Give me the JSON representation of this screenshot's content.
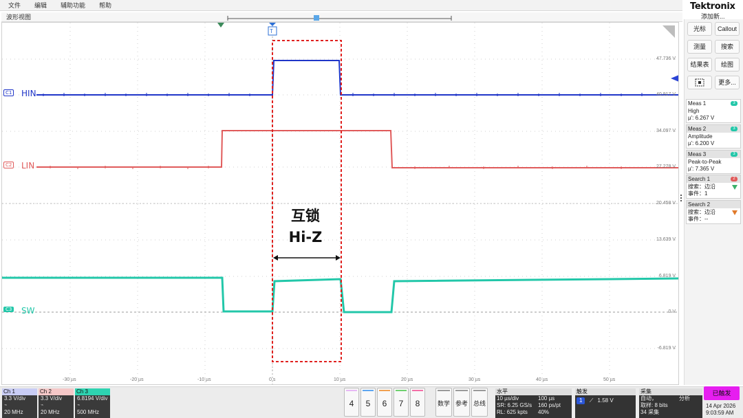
{
  "app": {
    "brand": "Tektronix",
    "add_new": "添加新...",
    "menu": [
      "文件",
      "编辑",
      "辅助功能",
      "帮助"
    ]
  },
  "waveform_view": {
    "title": "波形视图",
    "trigger_marker": "T",
    "overview_marker": "T",
    "volt_labels": [
      "47.736 V",
      "40.917 V",
      "34.097 V",
      "27.278 V",
      "20.458 V",
      "13.639 V",
      "6.819 V",
      "0 V",
      "-6.819 V"
    ],
    "time_labels": [
      "-30 µs",
      "-20 µs",
      "-10 µs",
      "0 s",
      "10 µs",
      "20 µs",
      "30 µs",
      "40 µs",
      "50 µs"
    ],
    "channels": [
      {
        "badge": "C1",
        "name": "HIN",
        "color": "#1f35c8"
      },
      {
        "badge": "C2",
        "name": "LIN",
        "color": "#e05a5a"
      },
      {
        "badge": "C3",
        "name": "SW",
        "color": "#22c7a9"
      }
    ],
    "annotation_line1": "互锁",
    "annotation_line2": "Hi-Z"
  },
  "right_panel": {
    "buttons": [
      {
        "label": "光标",
        "name": "cursor-button"
      },
      {
        "label": "Callout",
        "name": "callout-button"
      },
      {
        "label": "测量",
        "name": "measure-button"
      },
      {
        "label": "搜索",
        "name": "search-button"
      },
      {
        "label": "结果表",
        "name": "results-table-button"
      },
      {
        "label": "绘图",
        "name": "plot-button"
      },
      {
        "label": "更多...",
        "name": "more-button"
      }
    ],
    "measurements": [
      {
        "title": "Meas 1",
        "type": "High",
        "value": "µ': 6.267 V",
        "badge": "3"
      },
      {
        "title": "Meas 2",
        "type": "Amplitude",
        "value": "µ': 6.200 V",
        "badge": "3"
      },
      {
        "title": "Meas 3",
        "type": "Peak-to-Peak",
        "value": "µ': 7.365 V",
        "badge": "3"
      }
    ],
    "searches": [
      {
        "title": "Search 1",
        "line1": "搜索：边沿",
        "line2": "事件：1",
        "badge": "2",
        "badge_color": "#e05a5a",
        "tri_color": "#3cb06b"
      },
      {
        "title": "Search 2",
        "line1": "搜索：边沿",
        "line2": "事件：--",
        "tri_color": "#e07a2a"
      }
    ]
  },
  "bottom": {
    "channels": [
      {
        "name": "Ch 1",
        "scale": "3.3 V/div",
        "bw": "20 MHz",
        "color": "#c9cdf5"
      },
      {
        "name": "Ch 2",
        "scale": "3.3 V/div",
        "bw": "20 MHz",
        "color": "#f5c8c8"
      },
      {
        "name": "Ch 3",
        "scale": "6.8194 V/div",
        "bw": "500 MHz",
        "color": "#2ed3b1"
      }
    ],
    "num_buttons": [
      {
        "label": "4",
        "color": "#e7b8f5"
      },
      {
        "label": "5",
        "color": "#5da6f0"
      },
      {
        "label": "6",
        "color": "#f0a050"
      },
      {
        "label": "7",
        "color": "#6ed06e"
      },
      {
        "label": "8",
        "color": "#f36fa7"
      }
    ],
    "tool_buttons": [
      "数学",
      "参考",
      "总线"
    ],
    "horizontal": {
      "title": "水平",
      "row1a": "10 µs/div",
      "row1b": "100 µs",
      "row2a": "SR: 6.25 GS/s",
      "row2b": "160 ps/pt",
      "row3a": "RL: 625 kpts",
      "row3b": "40%"
    },
    "trigger": {
      "title": "触发",
      "source": "1",
      "level": "1.58 V"
    },
    "acquisition": {
      "title": "采集",
      "mode": "自动，",
      "analysis": "分析",
      "bits": "取样: 8 bits",
      "count": "34 采集"
    },
    "status": "已触发",
    "date": "14 Apr 2026",
    "time": "9:03:59 AM"
  }
}
